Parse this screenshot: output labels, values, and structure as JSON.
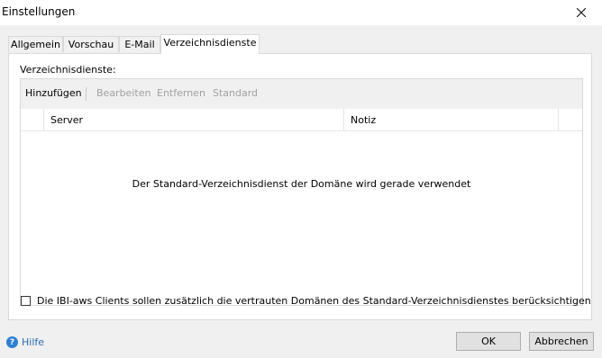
{
  "window": {
    "title": "Einstellungen"
  },
  "tabs": [
    {
      "label": "Allgemein"
    },
    {
      "label": "Vorschau"
    },
    {
      "label": "E-Mail"
    },
    {
      "label": "Verzeichnisdienste",
      "active": true
    }
  ],
  "section": {
    "label": "Verzeichnisdienste:"
  },
  "toolbar": {
    "add": "Hinzufügen",
    "edit": "Bearbeiten",
    "remove": "Entfernen",
    "default": "Standard"
  },
  "grid": {
    "columns": [
      "Server",
      "Notiz"
    ],
    "empty_message": "Der Standard-Verzeichnisdienst der Domäne wird gerade verwendet"
  },
  "trust_checkbox": {
    "label": "Die IBI-aws Clients sollen zusätzlich die vertrauten Domänen des Standard-Verzeichnisdienstes berücksichtigen",
    "checked": false
  },
  "footer": {
    "help": "Hilfe",
    "ok": "OK",
    "cancel": "Abbrechen"
  },
  "icons": {
    "close": "close-icon",
    "help": "help-icon"
  },
  "colors": {
    "link": "#2b6cb0",
    "disabled_text": "#a0a0a0"
  }
}
